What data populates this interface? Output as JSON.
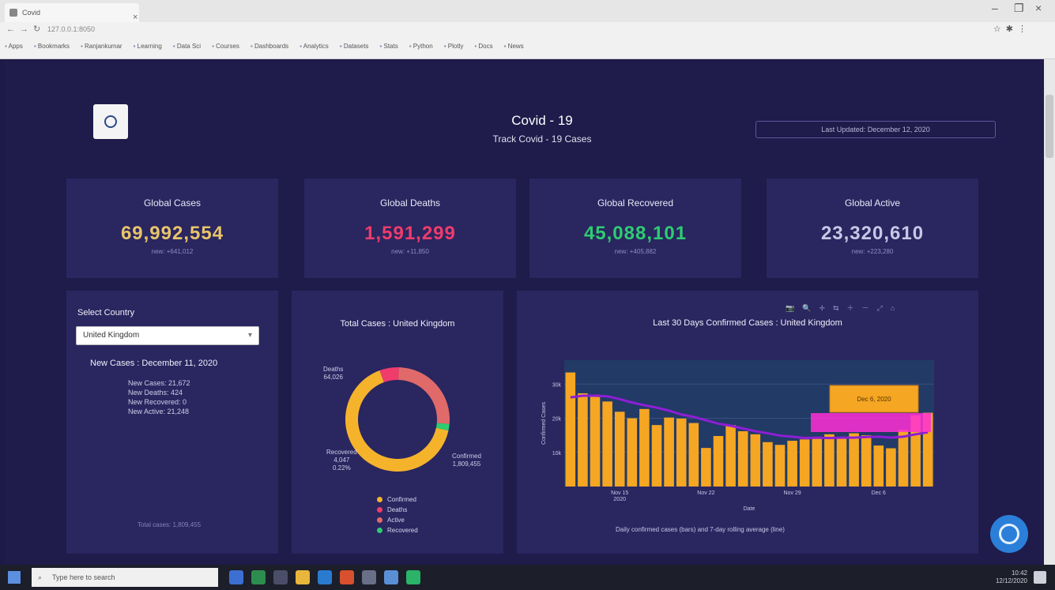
{
  "browser": {
    "tab_title": "Covid",
    "address": "127.0.0.1:8050",
    "bookmarks": [
      "Apps",
      "Bookmarks",
      "Ranjankumar",
      "Learning",
      "Data Sci",
      "Courses",
      "Dashboards",
      "Analytics",
      "Datasets",
      "Stats",
      "Python",
      "Plotly",
      "Docs",
      "News"
    ]
  },
  "header": {
    "title": "Covid - 19",
    "subtitle": "Track Covid - 19 Cases",
    "link": "Last Updated: December 12, 2020"
  },
  "cards": [
    {
      "label": "Global Cases",
      "value": "69,992,554",
      "sub": "new: +641,012",
      "color": "#e9c46a"
    },
    {
      "label": "Global Deaths",
      "value": "1,591,299",
      "sub": "new: +11,850",
      "color": "#ef3c6b"
    },
    {
      "label": "Global Recovered",
      "value": "45,088,101",
      "sub": "new: +405,882",
      "color": "#2ecc71"
    },
    {
      "label": "Global Active",
      "value": "23,320,610",
      "sub": "new: +223,280",
      "color": "#c9c7e6"
    }
  ],
  "left_panel": {
    "select_label": "Select Country",
    "select_value": "United Kingdom",
    "new_cases_title": "New Cases : December 11, 2020",
    "stats": [
      "New Cases: 21,672",
      "New Deaths: 424",
      "New Recovered: 0",
      "New Active: 21,248"
    ],
    "footer": "Total cases: 1,809,455"
  },
  "donut_panel": {
    "title": "Total Cases : United Kingdom",
    "labels": {
      "left_top": "Deaths\n64,026",
      "right": "Confirmed\n1,809,455",
      "left_bottom": "Recovered\n4,047\n0.22%"
    },
    "legend": [
      {
        "name": "Confirmed",
        "color": "#f5b32c"
      },
      {
        "name": "Deaths",
        "color": "#ef3c6b"
      },
      {
        "name": "Active",
        "color": "#e06a6a"
      },
      {
        "name": "Recovered",
        "color": "#2ecc71"
      }
    ]
  },
  "bar_panel": {
    "title": "Last 30 Days Confirmed Cases : United Kingdom",
    "modebar": [
      "📷",
      "🔍",
      "✛",
      "⇆",
      "＋",
      "－",
      "⤢",
      "⌂"
    ],
    "bottom_legend": "Daily confirmed cases (bars) and 7-day rolling average (line)"
  },
  "chart_data": {
    "type": "bar",
    "title": "Last 30 Days Confirmed Cases : United Kingdom",
    "xlabel": "Date",
    "ylabel": "Confirmed Cases",
    "x": [
      "2020-11-12",
      "2020-11-13",
      "2020-11-14",
      "2020-11-15",
      "2020-11-16",
      "2020-11-17",
      "2020-11-18",
      "2020-11-19",
      "2020-11-20",
      "2020-11-21",
      "2020-11-22",
      "2020-11-23",
      "2020-11-24",
      "2020-11-25",
      "2020-11-26",
      "2020-11-27",
      "2020-11-28",
      "2020-11-29",
      "2020-11-30",
      "2020-12-01",
      "2020-12-02",
      "2020-12-03",
      "2020-12-04",
      "2020-12-05",
      "2020-12-06",
      "2020-12-07",
      "2020-12-08",
      "2020-12-09",
      "2020-12-10",
      "2020-12-11"
    ],
    "series": [
      {
        "name": "Daily confirmed cases",
        "type": "bar",
        "color": "#f5a623",
        "values": [
          33400,
          27300,
          26900,
          24900,
          21900,
          20000,
          22700,
          18000,
          20200,
          19900,
          18600,
          11300,
          14800,
          18000,
          16200,
          15300,
          13000,
          12200,
          13400,
          13800,
          14100,
          15300,
          14500,
          15600,
          15000,
          12000,
          11200,
          16600,
          20900,
          21600
        ]
      },
      {
        "name": "7-day rolling average",
        "type": "line",
        "color": "#8e1ed6",
        "values": [
          26100,
          26600,
          26600,
          26400,
          25600,
          24600,
          23800,
          23100,
          22200,
          21100,
          20400,
          19400,
          18400,
          17800,
          17000,
          16200,
          15600,
          14900,
          14600,
          14200,
          14300,
          14200,
          14300,
          14300,
          14500,
          14600,
          14300,
          14600,
          15300,
          15900
        ]
      }
    ],
    "ylim": [
      0,
      37000
    ],
    "yticks": [
      10000,
      20000,
      30000
    ],
    "xticks": [
      "Nov 15\n2020",
      "Nov 22",
      "Nov 29",
      "Dec 6"
    ],
    "hover_box": {
      "label": "Dec 6, 2020",
      "color": "#f5a623",
      "highlight": "#ff2fd6"
    }
  },
  "taskbar": {
    "search_placeholder": "Type here to search",
    "time": "10:42",
    "date": "12/12/2020"
  }
}
